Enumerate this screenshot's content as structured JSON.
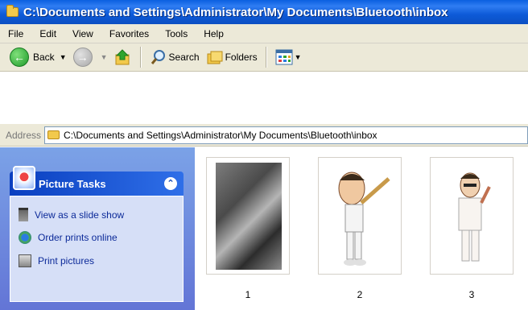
{
  "window": {
    "title": "C:\\Documents and Settings\\Administrator\\My Documents\\Bluetooth\\inbox"
  },
  "menu": [
    "File",
    "Edit",
    "View",
    "Favorites",
    "Tools",
    "Help"
  ],
  "toolbar": {
    "back": "Back",
    "search": "Search",
    "folders": "Folders"
  },
  "address": {
    "label": "Address",
    "value": "C:\\Documents and Settings\\Administrator\\My Documents\\Bluetooth\\inbox"
  },
  "tasks": {
    "title": "Picture Tasks",
    "items": [
      "View as a slide show",
      "Order prints online",
      "Print pictures"
    ]
  },
  "files": [
    {
      "name": "1"
    },
    {
      "name": "2"
    },
    {
      "name": "3"
    }
  ],
  "colors": {
    "title_bar": "#0b4fc2",
    "panel": "#6f8ddf",
    "task_link": "#0c2a99"
  }
}
